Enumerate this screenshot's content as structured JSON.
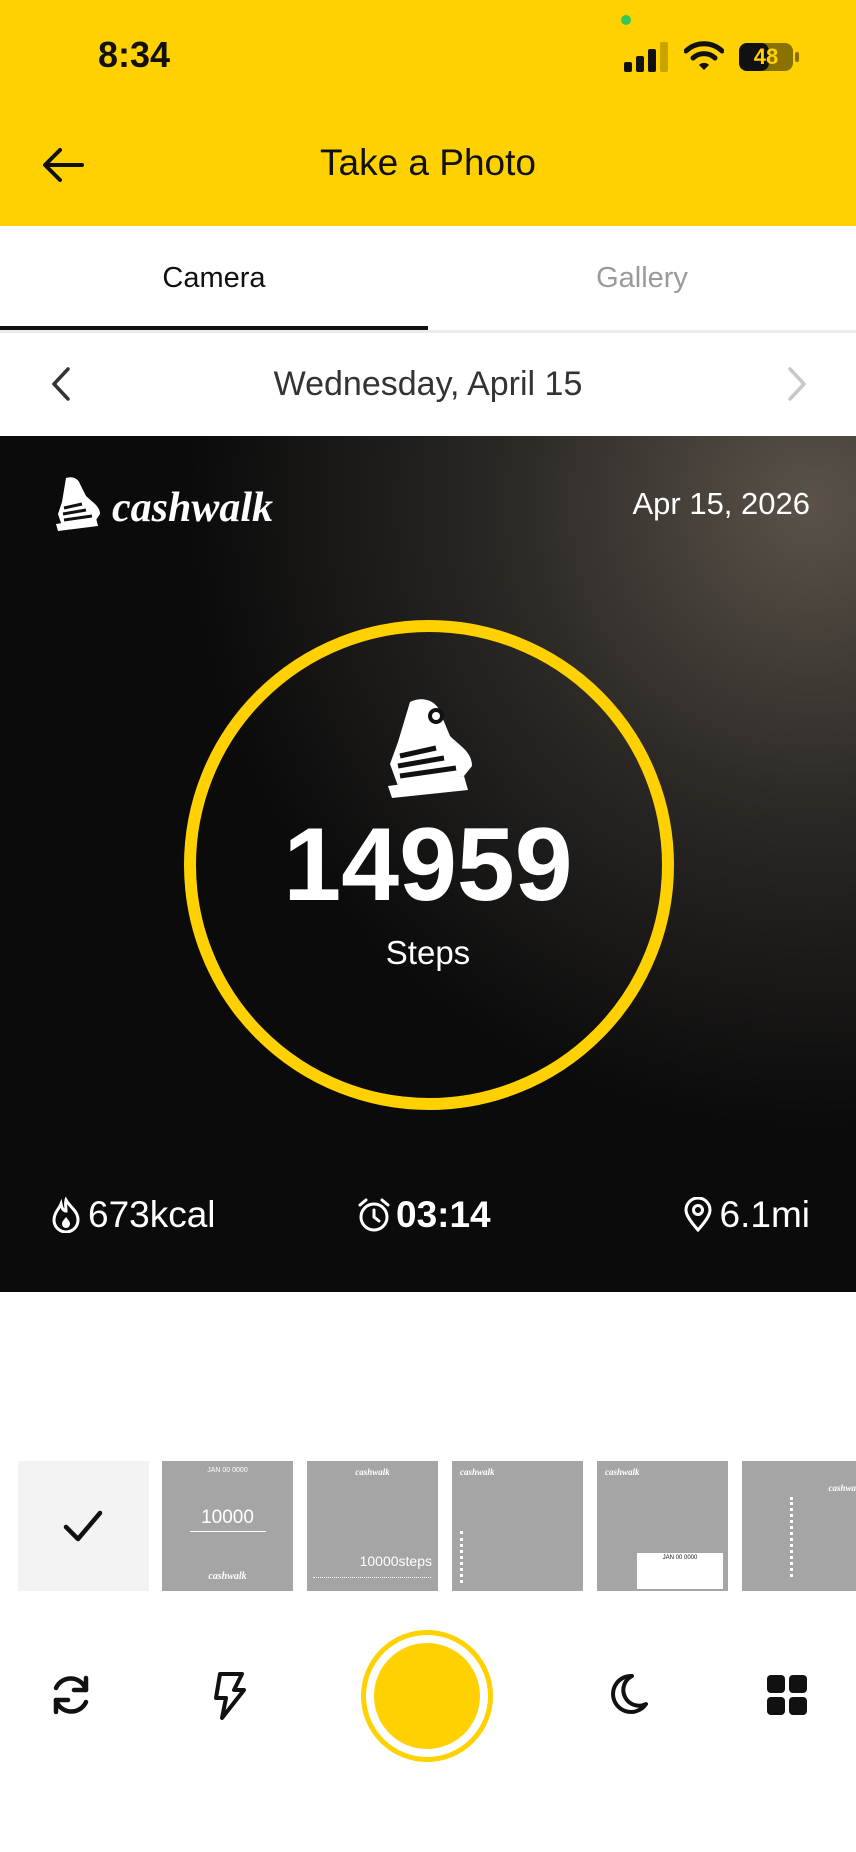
{
  "status_bar": {
    "time": "8:34",
    "battery": "48"
  },
  "header": {
    "title": "Take a Photo"
  },
  "tabs": [
    {
      "label": "Camera",
      "active": true
    },
    {
      "label": "Gallery",
      "active": false
    }
  ],
  "date_nav": {
    "title": "Wednesday, April 15"
  },
  "photo": {
    "brand": "cashwalk",
    "date": "Apr 15, 2026",
    "steps": "14959",
    "steps_label": "Steps",
    "calories": "673kcal",
    "duration": "03:14",
    "distance": "6.1mi"
  },
  "templates": [
    {
      "type": "selected"
    },
    {
      "top": "JAN 00 0000",
      "main": "10000",
      "brand": "cashwalk"
    },
    {
      "brand": "cashwalk",
      "main": "10000steps"
    },
    {
      "brand": "cashwalk"
    },
    {
      "brand": "cashwalk",
      "card": "JAN 00 0000"
    },
    {
      "brand": "cashwalk"
    }
  ],
  "colors": {
    "accent": "#FFD100",
    "text": "#111111",
    "muted": "#9A9A9A"
  },
  "icons": [
    "back-arrow-icon",
    "chevron-left-icon",
    "chevron-right-icon",
    "shoe-icon",
    "flame-icon",
    "alarm-clock-icon",
    "location-pin-icon",
    "refresh-icon",
    "flash-icon",
    "moon-icon",
    "grid-icon",
    "check-icon"
  ]
}
